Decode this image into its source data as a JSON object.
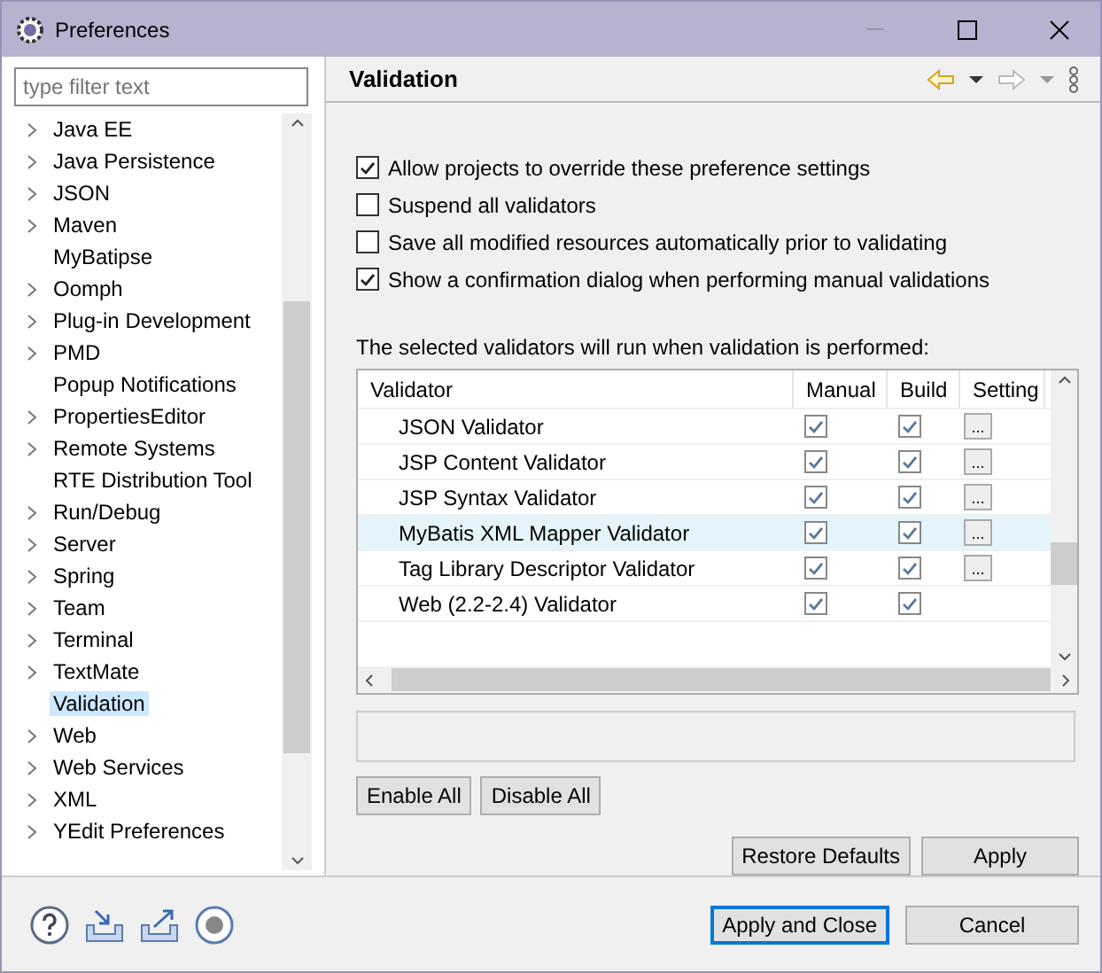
{
  "window": {
    "title": "Preferences"
  },
  "filter": {
    "placeholder": "type filter text"
  },
  "tree": [
    {
      "label": "Java EE",
      "expandable": true,
      "selected": false
    },
    {
      "label": "Java Persistence",
      "expandable": true,
      "selected": false
    },
    {
      "label": "JSON",
      "expandable": true,
      "selected": false
    },
    {
      "label": "Maven",
      "expandable": true,
      "selected": false
    },
    {
      "label": "MyBatipse",
      "expandable": false,
      "selected": false
    },
    {
      "label": "Oomph",
      "expandable": true,
      "selected": false
    },
    {
      "label": "Plug-in Development",
      "expandable": true,
      "selected": false
    },
    {
      "label": "PMD",
      "expandable": true,
      "selected": false
    },
    {
      "label": "Popup Notifications",
      "expandable": false,
      "selected": false
    },
    {
      "label": "PropertiesEditor",
      "expandable": true,
      "selected": false
    },
    {
      "label": "Remote Systems",
      "expandable": true,
      "selected": false
    },
    {
      "label": "RTE Distribution Tool",
      "expandable": false,
      "selected": false
    },
    {
      "label": "Run/Debug",
      "expandable": true,
      "selected": false
    },
    {
      "label": "Server",
      "expandable": true,
      "selected": false
    },
    {
      "label": "Spring",
      "expandable": true,
      "selected": false
    },
    {
      "label": "Team",
      "expandable": true,
      "selected": false
    },
    {
      "label": "Terminal",
      "expandable": true,
      "selected": false
    },
    {
      "label": "TextMate",
      "expandable": true,
      "selected": false
    },
    {
      "label": "Validation",
      "expandable": false,
      "selected": true
    },
    {
      "label": "Web",
      "expandable": true,
      "selected": false
    },
    {
      "label": "Web Services",
      "expandable": true,
      "selected": false
    },
    {
      "label": "XML",
      "expandable": true,
      "selected": false
    },
    {
      "label": "YEdit Preferences",
      "expandable": true,
      "selected": false
    }
  ],
  "page": {
    "title": "Validation"
  },
  "options": [
    {
      "label": "Allow projects to override these preference settings",
      "checked": true
    },
    {
      "label": "Suspend all validators",
      "checked": false
    },
    {
      "label": "Save all modified resources automatically prior to validating",
      "checked": false
    },
    {
      "label": "Show a confirmation dialog when performing manual validations",
      "checked": true
    }
  ],
  "table_caption": "The selected validators will run when validation is performed:",
  "table": {
    "columns": [
      "Validator",
      "Manual",
      "Build",
      "Setting"
    ],
    "rows": [
      {
        "name": "JSON Validator",
        "manual": true,
        "build": true,
        "settings": true,
        "selected": false
      },
      {
        "name": "JSP Content Validator",
        "manual": true,
        "build": true,
        "settings": true,
        "selected": false
      },
      {
        "name": "JSP Syntax Validator",
        "manual": true,
        "build": true,
        "settings": true,
        "selected": false
      },
      {
        "name": "MyBatis XML Mapper Validator",
        "manual": true,
        "build": true,
        "settings": true,
        "selected": true
      },
      {
        "name": "Tag Library Descriptor Validator",
        "manual": true,
        "build": true,
        "settings": true,
        "selected": false
      },
      {
        "name": "Web (2.2-2.4) Validator",
        "manual": true,
        "build": true,
        "settings": false,
        "selected": false
      }
    ]
  },
  "buttons": {
    "settings": "...",
    "enable_all": "Enable All",
    "disable_all": "Disable All",
    "restore": "Restore Defaults",
    "apply": "Apply",
    "apply_close": "Apply and Close",
    "cancel": "Cancel"
  }
}
